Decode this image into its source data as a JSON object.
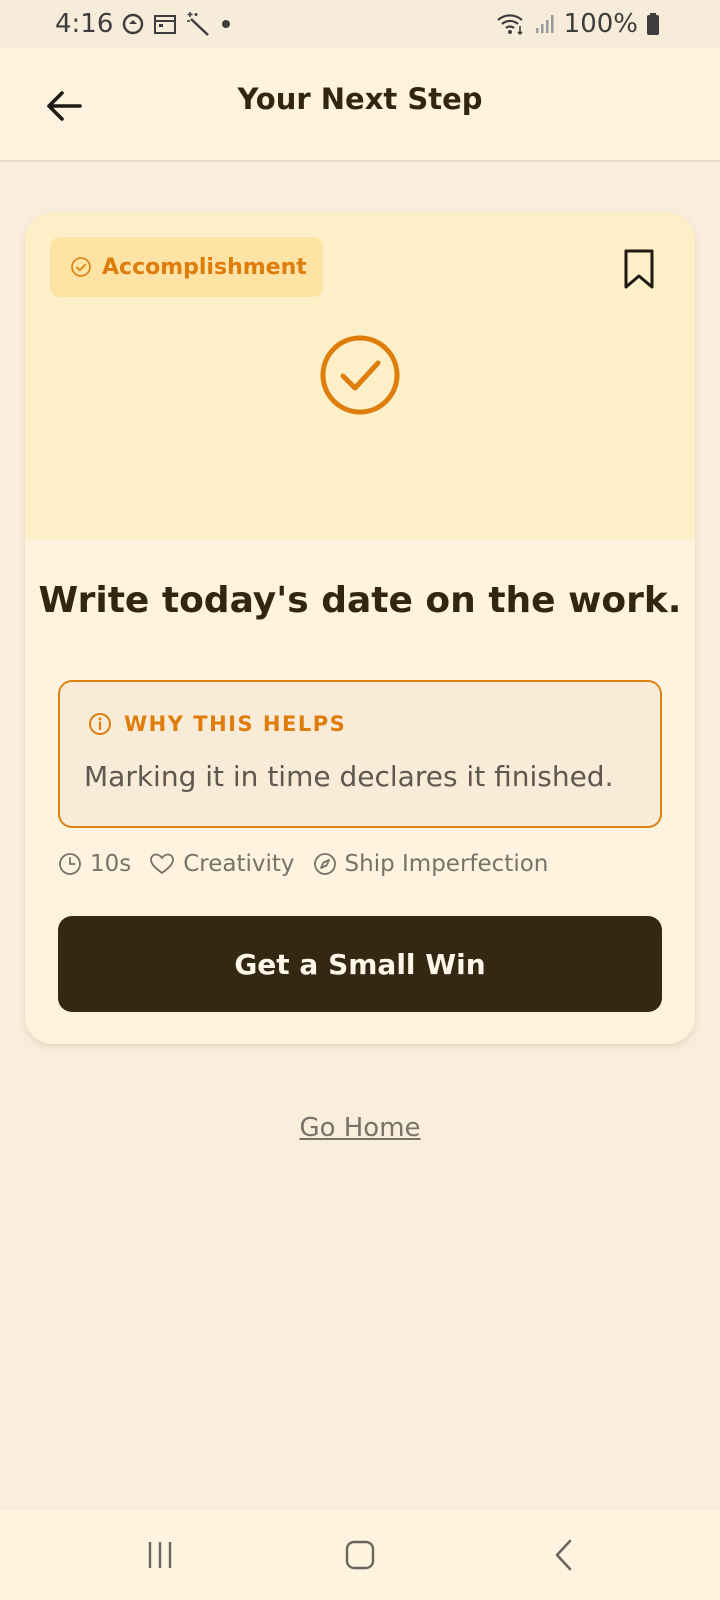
{
  "status_bar": {
    "time": "4:16",
    "battery": "100%",
    "icons": [
      "sync-icon",
      "calendar-icon",
      "magic-wand-icon",
      "dot-icon",
      "wifi-icon",
      "signal-icon",
      "battery-icon"
    ]
  },
  "app_bar": {
    "title": "Your Next Step",
    "back_icon": "arrow-left-icon"
  },
  "card": {
    "category": "Accomplishment",
    "task": "Write today's date on the work.",
    "why": {
      "heading": "WHY THIS HELPS",
      "text": "Marking it in time declares it finished."
    },
    "meta": {
      "duration": "10s",
      "value": "Creativity",
      "principle": "Ship Imperfection"
    },
    "primary_button": "Get a Small Win"
  },
  "links": {
    "go_home": "Go Home"
  },
  "colors": {
    "accent": "#de7c0c",
    "primary_button": "#352813",
    "background": "#f9eedc",
    "hero": "#fdefc8"
  }
}
